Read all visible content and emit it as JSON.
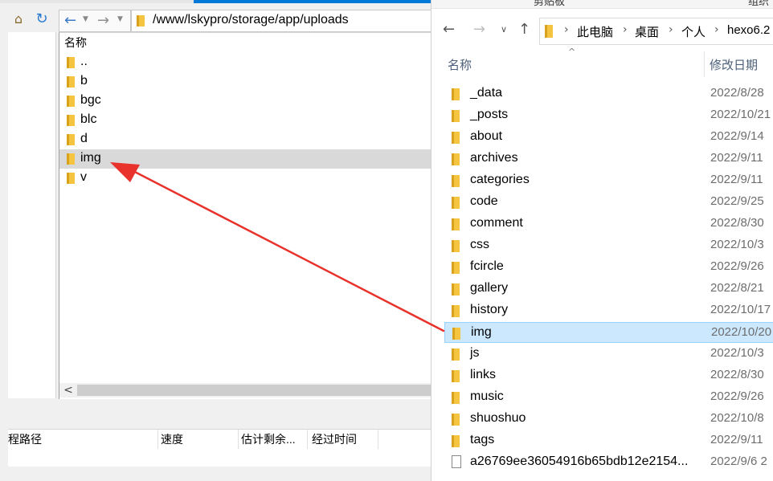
{
  "left": {
    "path": "/www/lskypro/storage/app/uploads",
    "list_header": "名称",
    "items": [
      {
        "name": ".."
      },
      {
        "name": "b"
      },
      {
        "name": "bgc"
      },
      {
        "name": "blc"
      },
      {
        "name": "d"
      },
      {
        "name": "img",
        "selected": true
      },
      {
        "name": "v"
      }
    ],
    "scroll_left": "<",
    "transfer_columns": [
      "程路径",
      "速度",
      "估计剩余...",
      "经过时间"
    ]
  },
  "right": {
    "ribbon_labels": [
      "剪贴板",
      "组织"
    ],
    "breadcrumb": [
      "此电脑",
      "桌面",
      "个人",
      "hexo6.2"
    ],
    "columns": {
      "name": "名称",
      "date": "修改日期"
    },
    "items": [
      {
        "name": "_data",
        "date": "2022/8/28"
      },
      {
        "name": "_posts",
        "date": "2022/10/21"
      },
      {
        "name": "about",
        "date": "2022/9/14"
      },
      {
        "name": "archives",
        "date": "2022/9/11"
      },
      {
        "name": "categories",
        "date": "2022/9/11"
      },
      {
        "name": "code",
        "date": "2022/9/25"
      },
      {
        "name": "comment",
        "date": "2022/8/30"
      },
      {
        "name": "css",
        "date": "2022/10/3"
      },
      {
        "name": "fcircle",
        "date": "2022/9/26"
      },
      {
        "name": "gallery",
        "date": "2022/8/21"
      },
      {
        "name": "history",
        "date": "2022/10/17"
      },
      {
        "name": "img",
        "date": "2022/10/20",
        "selected": true
      },
      {
        "name": "js",
        "date": "2022/10/3"
      },
      {
        "name": "links",
        "date": "2022/8/30"
      },
      {
        "name": "music",
        "date": "2022/9/26"
      },
      {
        "name": "shuoshuo",
        "date": "2022/10/8"
      },
      {
        "name": "tags",
        "date": "2022/9/11"
      },
      {
        "name": "a26769ee36054916b65bdb12e2154...",
        "date": "2022/9/6 2",
        "type": "file"
      }
    ]
  },
  "colors": {
    "folder": "#f5c542",
    "annotation": "#e8322b",
    "selection_left": "#d9d9d9",
    "selection_right": "#cce8ff",
    "accent": "#0078d7"
  },
  "icons": [
    "home-icon",
    "refresh-icon",
    "back-arrow-icon",
    "forward-arrow-icon",
    "up-arrow-icon",
    "folder-icon",
    "file-icon",
    "chevron-right-icon"
  ]
}
